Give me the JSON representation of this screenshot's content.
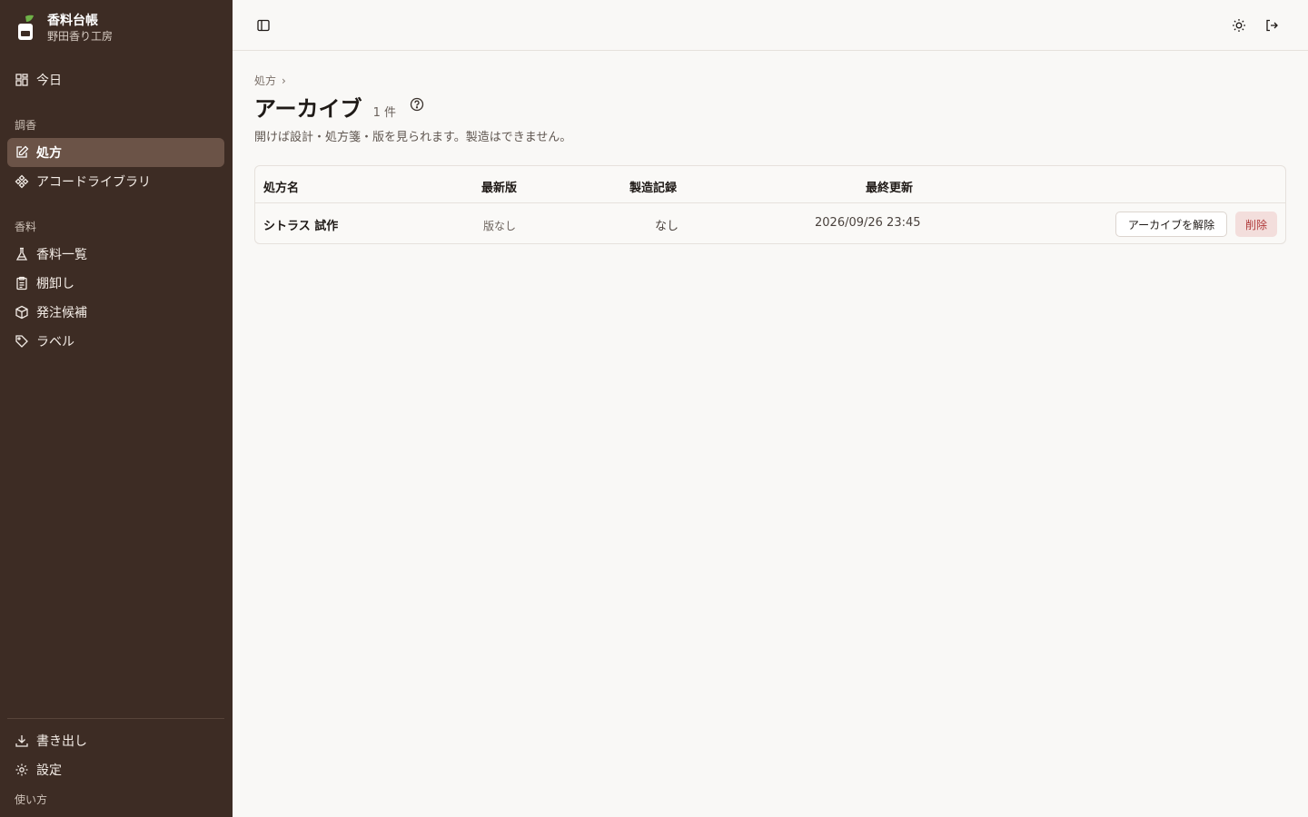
{
  "brand": {
    "title": "香料台帳",
    "subtitle": "野田香り工房"
  },
  "sidebar": {
    "today": "今日",
    "section_blend": "調香",
    "formulas": "処方",
    "accord_library": "アコードライブラリ",
    "section_materials": "香料",
    "materials_list": "香料一覧",
    "stocktake": "棚卸し",
    "order_candidates": "発注候補",
    "labels": "ラベル",
    "export": "書き出し",
    "settings": "設定",
    "help": "使い方"
  },
  "breadcrumb": {
    "parent": "処方",
    "separator": "›"
  },
  "page": {
    "title": "アーカイブ",
    "count": "1 件",
    "description": "開けば設計・処方箋・版を見られます。製造はできません。"
  },
  "table": {
    "headers": {
      "name": "処方名",
      "latest_version": "最新版",
      "production": "製造記録",
      "updated": "最終更新"
    },
    "rows": [
      {
        "name": "シトラス 試作",
        "latest_version": "版なし",
        "production": "なし",
        "updated": "2026/09/26 23:45",
        "unarchive": "アーカイブを解除",
        "delete": "削除"
      }
    ]
  },
  "colors": {
    "sidebar_bg": "#3d2c24",
    "active_bg": "#6b5347",
    "accent_green": "#5a9a3c",
    "danger": "#b03a3a"
  }
}
